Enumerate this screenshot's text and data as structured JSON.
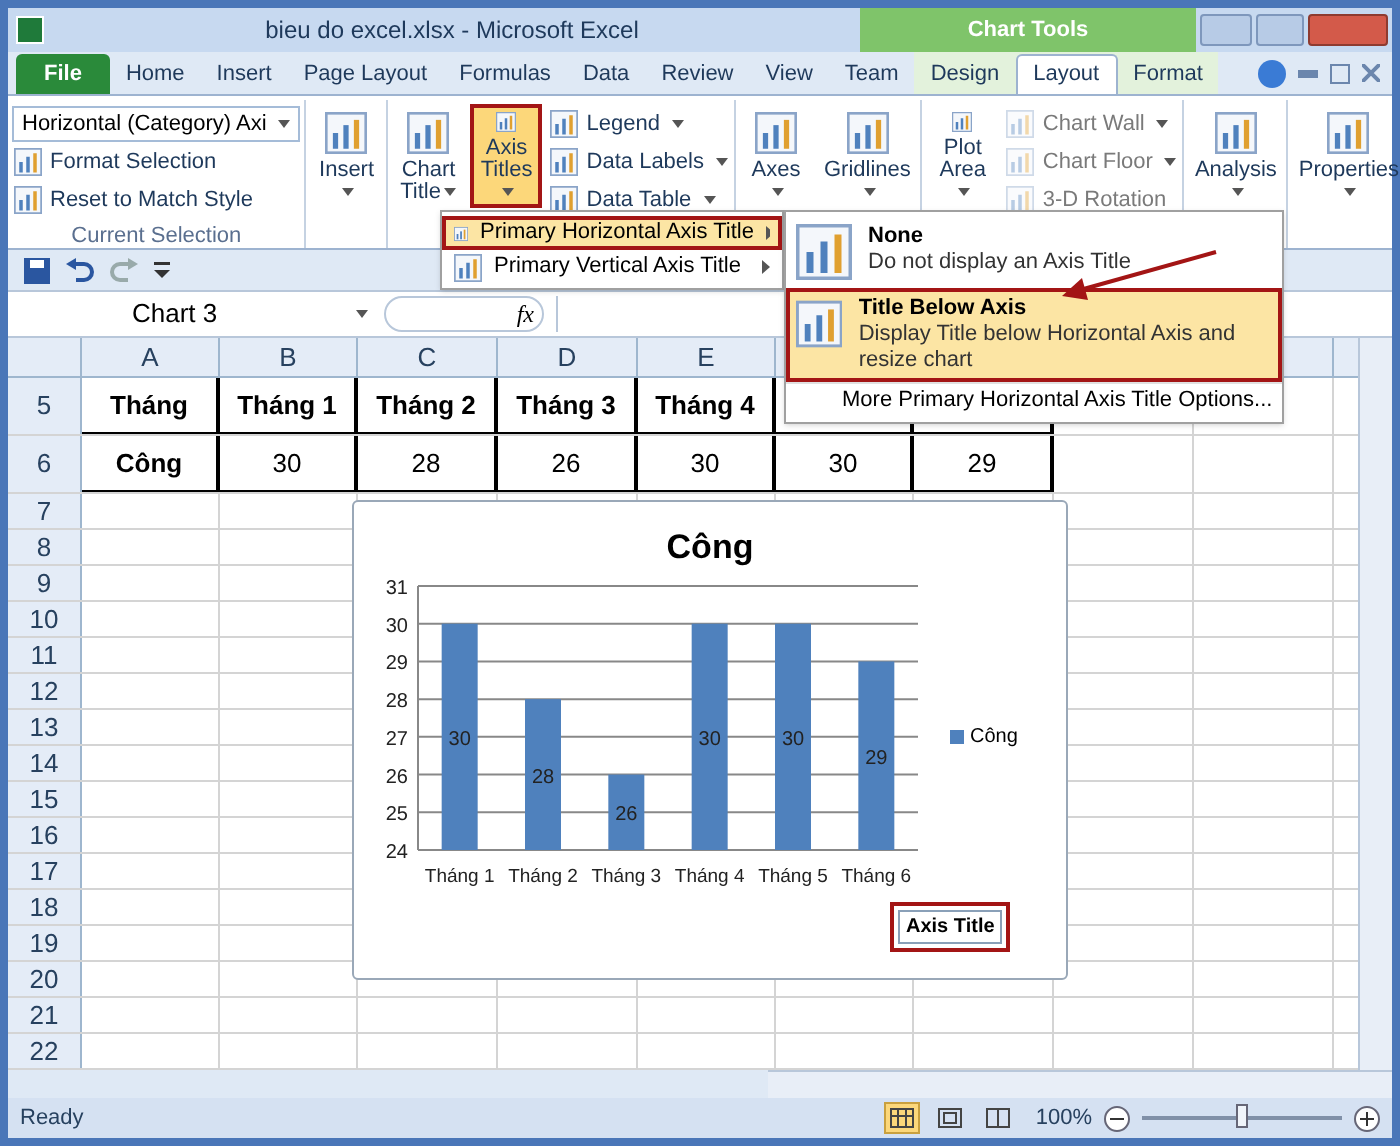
{
  "window": {
    "title": "bieu do excel.xlsx  -  Microsoft Excel",
    "contextual_group": "Chart Tools"
  },
  "tabs": [
    {
      "label": "File",
      "kind": "file",
      "selected": false
    },
    {
      "label": "Home",
      "kind": "plain",
      "selected": false
    },
    {
      "label": "Insert",
      "kind": "plain",
      "selected": false
    },
    {
      "label": "Page Layout",
      "kind": "plain",
      "selected": false
    },
    {
      "label": "Formulas",
      "kind": "plain",
      "selected": false
    },
    {
      "label": "Data",
      "kind": "plain",
      "selected": false
    },
    {
      "label": "Review",
      "kind": "plain",
      "selected": false
    },
    {
      "label": "View",
      "kind": "plain",
      "selected": false
    },
    {
      "label": "Team",
      "kind": "plain",
      "selected": false
    },
    {
      "label": "Design",
      "kind": "contextual",
      "selected": false
    },
    {
      "label": "Layout",
      "kind": "contextual",
      "selected": true
    },
    {
      "label": "Format",
      "kind": "contextual",
      "selected": false
    }
  ],
  "ribbon": {
    "groups": [
      {
        "label": "Current Selection",
        "items": [
          {
            "kind": "dropdown",
            "label": "Horizontal (Category) Axi",
            "disabled": false,
            "has_menu": true
          },
          {
            "kind": "small",
            "label": "Format Selection",
            "selected": false,
            "disabled": false,
            "has_menu": false
          },
          {
            "kind": "small",
            "label": "Reset to Match Style",
            "selected": false,
            "disabled": false,
            "has_menu": false
          }
        ]
      },
      {
        "items": [
          {
            "kind": "large",
            "label": "Insert",
            "selected": false,
            "disabled": false,
            "has_menu": true
          }
        ]
      },
      {
        "items": [
          {
            "kind": "large",
            "label": "Chart Title",
            "selected": false,
            "disabled": false,
            "has_menu": true
          },
          {
            "kind": "large",
            "label": "Axis Titles",
            "selected": true,
            "disabled": false,
            "has_menu": true
          },
          {
            "kind": "small",
            "label": "Legend",
            "selected": false,
            "disabled": false,
            "has_menu": true
          },
          {
            "kind": "small",
            "label": "Data Labels",
            "selected": false,
            "disabled": false,
            "has_menu": true
          },
          {
            "kind": "small",
            "label": "Data Table",
            "selected": false,
            "disabled": false,
            "has_menu": true
          }
        ]
      },
      {
        "items": [
          {
            "kind": "large",
            "label": "Axes",
            "selected": false,
            "disabled": false,
            "has_menu": true
          },
          {
            "kind": "large",
            "label": "Gridlines",
            "selected": false,
            "disabled": false,
            "has_menu": true
          }
        ]
      },
      {
        "items": [
          {
            "kind": "large",
            "label": "Plot Area",
            "selected": false,
            "disabled": false,
            "has_menu": true
          },
          {
            "kind": "small",
            "label": "Chart Wall",
            "selected": false,
            "disabled": true,
            "has_menu": true
          },
          {
            "kind": "small",
            "label": "Chart Floor",
            "selected": false,
            "disabled": true,
            "has_menu": true
          },
          {
            "kind": "small",
            "label": "3-D Rotation",
            "selected": false,
            "disabled": true,
            "has_menu": false
          }
        ]
      },
      {
        "items": [
          {
            "kind": "large",
            "label": "Analysis",
            "selected": false,
            "disabled": false,
            "has_menu": true
          }
        ]
      },
      {
        "items": [
          {
            "kind": "large",
            "label": "Properties",
            "selected": false,
            "disabled": false,
            "has_menu": true
          }
        ]
      }
    ]
  },
  "axis_titles_menu": {
    "items": [
      {
        "label": "Primary Horizontal Axis Title",
        "selected": true
      },
      {
        "label": "Primary Vertical Axis Title",
        "selected": false
      }
    ]
  },
  "axis_title_submenu": {
    "items": [
      {
        "title": "None",
        "description": "Do not display an Axis Title",
        "selected": false
      },
      {
        "title": "Title Below Axis",
        "description": "Display Title below Horizontal Axis and resize chart",
        "selected": true
      }
    ],
    "footer": "More Primary Horizontal Axis Title Options..."
  },
  "formula_bar": {
    "name_box": "Chart 3",
    "function_label": "fx"
  },
  "sheet": {
    "columns": [
      "A",
      "B",
      "C",
      "D",
      "E"
    ],
    "rows": [
      {
        "header": "5",
        "kind": "header",
        "cells": [
          "Tháng",
          "Tháng 1",
          "Tháng 2",
          "Tháng 3",
          "Tháng 4"
        ]
      },
      {
        "header": "6",
        "kind": "data",
        "cells": [
          "Công",
          "30",
          "28",
          "26",
          "30",
          "30",
          "29"
        ]
      }
    ],
    "empty_rows": [
      "7",
      "8",
      "9",
      "10",
      "11",
      "12",
      "13",
      "14",
      "15",
      "16",
      "17",
      "18",
      "19",
      "20",
      "21",
      "22"
    ]
  },
  "chart": {
    "axis_title": "Axis Title",
    "chart_data": {
      "type": "bar",
      "title": "Công",
      "categories": [
        "Tháng 1",
        "Tháng 2",
        "Tháng 3",
        "Tháng 4",
        "Tháng 5",
        "Tháng 6"
      ],
      "series": [
        {
          "name": "Công",
          "color": "#4f81bd",
          "values": [
            30,
            28,
            26,
            30,
            30,
            29
          ]
        }
      ],
      "ylim": [
        24,
        31
      ],
      "yticks": [
        24,
        25,
        26,
        27,
        28,
        29,
        30,
        31
      ],
      "grid": true,
      "data_labels": true
    }
  },
  "status_bar": {
    "text": "Ready",
    "zoom": "100%",
    "zoom_slider": {
      "level": 0.5
    },
    "views": [
      {
        "kind": "normal",
        "selected": true
      },
      {
        "kind": "page_layout",
        "selected": false
      },
      {
        "kind": "page_break",
        "selected": false
      }
    ]
  }
}
